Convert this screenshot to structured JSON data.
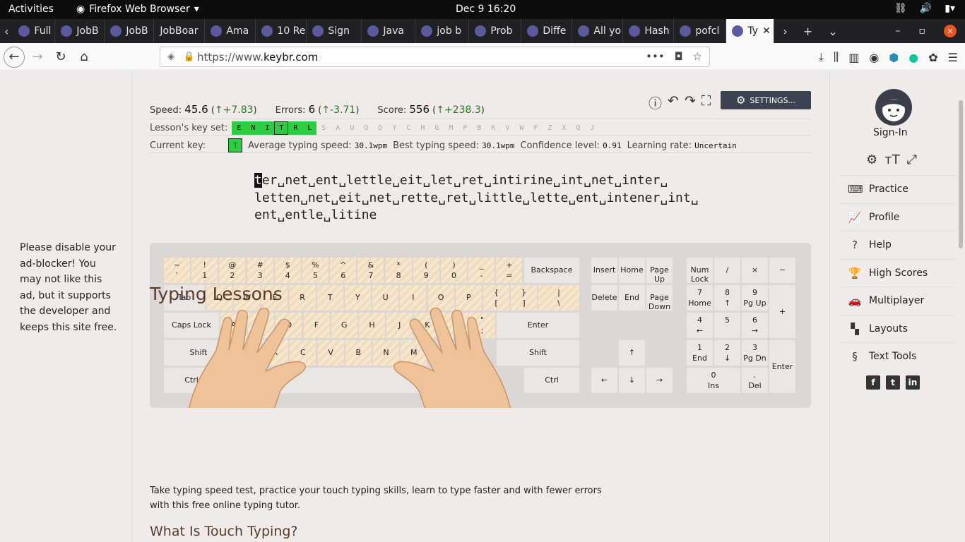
{
  "system": {
    "activities": "Activities",
    "app": "Firefox Web Browser",
    "clock": "Dec 9  16:20"
  },
  "tabs": [
    {
      "label": "Full m",
      "icon": "document-icon"
    },
    {
      "label": "JobB",
      "icon": "jobboard-icon"
    },
    {
      "label": "JobB",
      "icon": "jobboard-icon"
    },
    {
      "label": "JobBoar",
      "icon": "none"
    },
    {
      "label": "Ama",
      "icon": "aws-icon"
    },
    {
      "label": "10 Re",
      "icon": "dev-icon"
    },
    {
      "label": "Sign",
      "icon": "replit-icon"
    },
    {
      "label": "Java",
      "icon": "ib-icon"
    },
    {
      "label": "job b",
      "icon": "facebook-icon"
    },
    {
      "label": "Prob",
      "icon": "warning-icon"
    },
    {
      "label": "Diffe",
      "icon": "shield-icon"
    },
    {
      "label": "All yo",
      "icon": "c-icon"
    },
    {
      "label": "Hash",
      "icon": "c-icon"
    },
    {
      "label": "pofcl",
      "icon": "p-icon"
    },
    {
      "label": "Ty",
      "icon": "keybr-icon",
      "active": true
    }
  ],
  "url": {
    "prefix": "https://www.",
    "domain": "keybr.com"
  },
  "ad": {
    "text": "Please disable your ad-blocker! You may not like this ad, but it supports the developer and keeps this site free."
  },
  "sidebar": {
    "signin": "Sign-In",
    "items": [
      {
        "label": "Practice",
        "icon": "keyboard-icon"
      },
      {
        "label": "Profile",
        "icon": "chart-icon"
      },
      {
        "label": "Help",
        "icon": "help-icon"
      },
      {
        "label": "High Scores",
        "icon": "trophy-icon"
      },
      {
        "label": "Multiplayer",
        "icon": "car-icon"
      },
      {
        "label": "Layouts",
        "icon": "layout-icon"
      },
      {
        "label": "Text Tools",
        "icon": "section-icon"
      }
    ]
  },
  "stats": {
    "speed_label": "Speed:",
    "speed": "45.6",
    "speed_delta": "↑+7.83",
    "errors_label": "Errors:",
    "errors": "6",
    "errors_delta": "↑-3.71",
    "score_label": "Score:",
    "score": "556",
    "score_delta": "↑+238.3"
  },
  "settings_label": "SETTINGS...",
  "keyset": {
    "label": "Lesson's key set:",
    "keys": [
      {
        "k": "E",
        "on": true
      },
      {
        "k": "N",
        "on": true
      },
      {
        "k": "I",
        "on": true
      },
      {
        "k": "T",
        "on": true,
        "cur": true
      },
      {
        "k": "R",
        "on": true
      },
      {
        "k": "L",
        "on": true
      },
      {
        "k": "S"
      },
      {
        "k": "A"
      },
      {
        "k": "U"
      },
      {
        "k": "O"
      },
      {
        "k": "D"
      },
      {
        "k": "Y"
      },
      {
        "k": "C"
      },
      {
        "k": "H"
      },
      {
        "k": "G"
      },
      {
        "k": "M"
      },
      {
        "k": "P"
      },
      {
        "k": "B"
      },
      {
        "k": "K"
      },
      {
        "k": "V"
      },
      {
        "k": "W"
      },
      {
        "k": "F"
      },
      {
        "k": "Z"
      },
      {
        "k": "X"
      },
      {
        "k": "Q"
      },
      {
        "k": "J"
      }
    ]
  },
  "current": {
    "label": "Current key:",
    "key": "T",
    "avg_label": "Average typing speed:",
    "avg": "30.1wpm",
    "best_label": "Best typing speed:",
    "best": "30.1wpm",
    "conf_label": "Confidence level:",
    "conf": "0.91",
    "rate_label": "Learning rate:",
    "rate": "Uncertain"
  },
  "lesson": {
    "cursor": "t",
    "line1": "er␣net␣ent␣lettle␣eit␣let␣ret␣intirine␣int␣net␣inter␣",
    "line2": "letten␣net␣eit␣net␣rette␣ret␣little␣lette␣ent␣intener␣int␣",
    "line3": "ent␣entle␣litine"
  },
  "content": {
    "h2": "Typing Lessons",
    "p": "Take typing speed test, practice your touch typing skills, learn to type faster and with fewer errors with this free online typing tutor.",
    "h3": "What Is Touch Typing?"
  }
}
